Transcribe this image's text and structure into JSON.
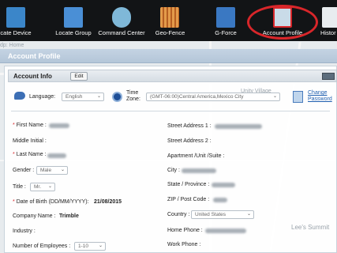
{
  "nav": {
    "items": [
      {
        "label": "cate Device",
        "icon": "locate-device-icon",
        "color": "#3b86c9"
      },
      {
        "label": "Locate Group",
        "icon": "locate-group-icon",
        "color": "#4a8fd6"
      },
      {
        "label": "Command Center",
        "icon": "command-center-icon",
        "color": "#7fb8d8"
      },
      {
        "label": "Geo-Fence",
        "icon": "geo-fence-icon",
        "color": "#d9803a"
      },
      {
        "label": "G-Force",
        "icon": "g-force-icon",
        "color": "#3a78c2"
      },
      {
        "label": "Account Profile",
        "icon": "account-profile-icon",
        "color": "#c9dbe8"
      },
      {
        "label": "Histor",
        "icon": "history-icon",
        "color": "#e8ecef"
      }
    ],
    "highlight_color": "#d8262a"
  },
  "panel": {
    "title": "Account Profile",
    "crumb_fragment": "dp: Home"
  },
  "section": {
    "title": "Account Info",
    "edit_label": "Edit"
  },
  "prefs": {
    "language_label": "Language:",
    "language_value": "English",
    "timezone_label_1": "Time",
    "timezone_label_2": "Zone:",
    "timezone_value": "(GMT-06:00)Central America,Mexico City",
    "change_password_1": "Change",
    "change_password_2": "Password"
  },
  "left": {
    "first_name": "First Name :",
    "middle_initial": "Middle Initial :",
    "last_name": "Last Name :",
    "gender": "Gender :",
    "gender_value": "Male",
    "title": "Title :",
    "title_value": "Mr.",
    "dob": "Date of Birth (DD/MM/YYYY):",
    "dob_value": "21/08/2015",
    "company": "Company Name :",
    "company_value": "Trimble",
    "industry": "Industry :",
    "employees": "Number of Employees :",
    "employees_value": "1-10"
  },
  "right": {
    "street1": "Street Address 1 :",
    "street2": "Street Address 2 :",
    "apartment": "Apartment /Unit /Suite :",
    "city": "City :",
    "state": "State / Province :",
    "zip": "ZIP / Post Code :",
    "country": "Country :",
    "country_value": "United States",
    "home_phone": "Home Phone :",
    "work_phone": "Work Phone :"
  },
  "map": {
    "label_unity": "Unity Village",
    "label_lees": "Lee's Summit"
  }
}
